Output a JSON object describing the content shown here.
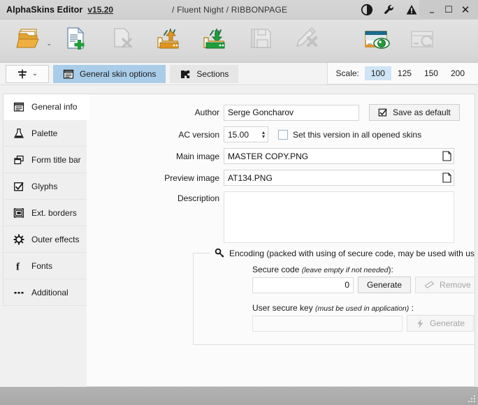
{
  "titlebar": {
    "app_name": "AlphaSkins Editor",
    "version": "v15.20",
    "breadcrumb": "/ Fluent Night / RIBBONPAGE",
    "icons": [
      {
        "name": "contrast-icon"
      },
      {
        "name": "wrench-icon"
      },
      {
        "name": "warning-icon"
      }
    ],
    "window_controls": {
      "minimize": "–",
      "maximize": "☐",
      "close": "✕"
    }
  },
  "toolbar": {
    "items": [
      {
        "name": "open-skin-button",
        "icon": "folder-open-icon",
        "label": "Open",
        "enabled": true,
        "has_dropdown": true
      },
      {
        "name": "new-skin-button",
        "icon": "new-document-icon",
        "label": "New",
        "enabled": true,
        "has_dropdown": false
      },
      {
        "name": "delete-skin-button",
        "icon": "delete-document-icon",
        "label": "Delete",
        "enabled": false,
        "has_dropdown": false
      },
      {
        "name": "export-skin-button",
        "icon": "export-upload-icon",
        "label": "Export",
        "enabled": true,
        "has_dropdown": false
      },
      {
        "name": "import-skin-button",
        "icon": "import-download-icon",
        "label": "Import",
        "enabled": true,
        "has_dropdown": false
      },
      {
        "name": "save-skin-button",
        "icon": "save-disk-icon",
        "label": "Save",
        "enabled": false,
        "has_dropdown": false
      },
      {
        "name": "edit-delete-button",
        "icon": "pencil-delete-icon",
        "label": "Edit",
        "enabled": false,
        "has_dropdown": false
      },
      {
        "name": "preview-skin-button",
        "icon": "preview-eye-icon",
        "label": "Preview",
        "enabled": true,
        "has_dropdown": false
      },
      {
        "name": "refresh-skin-button",
        "icon": "refresh-window-icon",
        "label": "Refresh",
        "enabled": false,
        "has_dropdown": false
      }
    ]
  },
  "tabstrip": {
    "pin_button": {
      "name": "options-pin-button",
      "icon": "signpost-icon",
      "caret": "⌄"
    },
    "tabs": [
      {
        "label": "General  skin options",
        "icon": "notepad-icon",
        "active": true
      },
      {
        "label": "Sections",
        "icon": "puzzle-icon",
        "active": false
      }
    ],
    "scale": {
      "label": "Scale:",
      "options": [
        "100",
        "125",
        "150",
        "200"
      ],
      "selected": "100"
    }
  },
  "sidebar": {
    "items": [
      {
        "label": "General info",
        "icon": "notepad-icon",
        "active": true
      },
      {
        "label": "Palette",
        "icon": "flask-icon",
        "active": false
      },
      {
        "label": "Form title bar",
        "icon": "windows-icon",
        "active": false
      },
      {
        "label": "Glyphs",
        "icon": "checkbox-icon",
        "active": false
      },
      {
        "label": "Ext. borders",
        "icon": "borders-icon",
        "active": false
      },
      {
        "label": "Outer effects",
        "icon": "gear-outline-icon",
        "active": false
      },
      {
        "label": "Fonts",
        "icon": "font-f-icon",
        "active": false
      },
      {
        "label": "Additional",
        "icon": "ellipsis-icon",
        "active": false
      }
    ]
  },
  "form": {
    "author": {
      "label": "Author",
      "value": "Serge Goncharov",
      "placeholder": ""
    },
    "save_as_default": {
      "label": "Save as default",
      "checked": true
    },
    "ac_version": {
      "label": "AC version",
      "value": "15.00",
      "spin_up": "▴",
      "spin_down": "▾"
    },
    "set_version_all": {
      "label": "Set this version in all opened skins",
      "checked": false
    },
    "main_image": {
      "label": "Main image",
      "value": "MASTER COPY.PNG",
      "browse_icon": "file-page-icon"
    },
    "preview_image": {
      "label": "Preview image",
      "value": "AT134.PNG",
      "browse_icon": "file-page-icon"
    },
    "description": {
      "label": "Description",
      "value": "",
      "placeholder": ""
    }
  },
  "encoding": {
    "title": "Encoding (packed with using of secure code, may be used with user password)",
    "title_icon": "key-icon",
    "secure_code": {
      "label_main": "Secure code ",
      "label_hint": "(leave empty if not needed",
      "label_tail": "):",
      "value": "0",
      "generate_button": "Generate",
      "remove_button": "Remove",
      "remove_enabled": false,
      "remove_icon": "eraser-icon"
    },
    "user_secure_key": {
      "label_main": "User secure key ",
      "label_hint": "(must be used in application)",
      "label_tail": " :",
      "value": "",
      "generate_button": "Generate",
      "generate_enabled": false,
      "generate_icon": "lightning-icon"
    }
  },
  "statusbar": {
    "text": "",
    "grip": "resize-grip-icon"
  },
  "colors": {
    "accent_tab": "#a9cde9",
    "scale_selected": "#cfe4f5",
    "titlebar": "#d6d6d6",
    "content_bg": "#fbfbfb",
    "statusbar": "#b3b3b3"
  }
}
